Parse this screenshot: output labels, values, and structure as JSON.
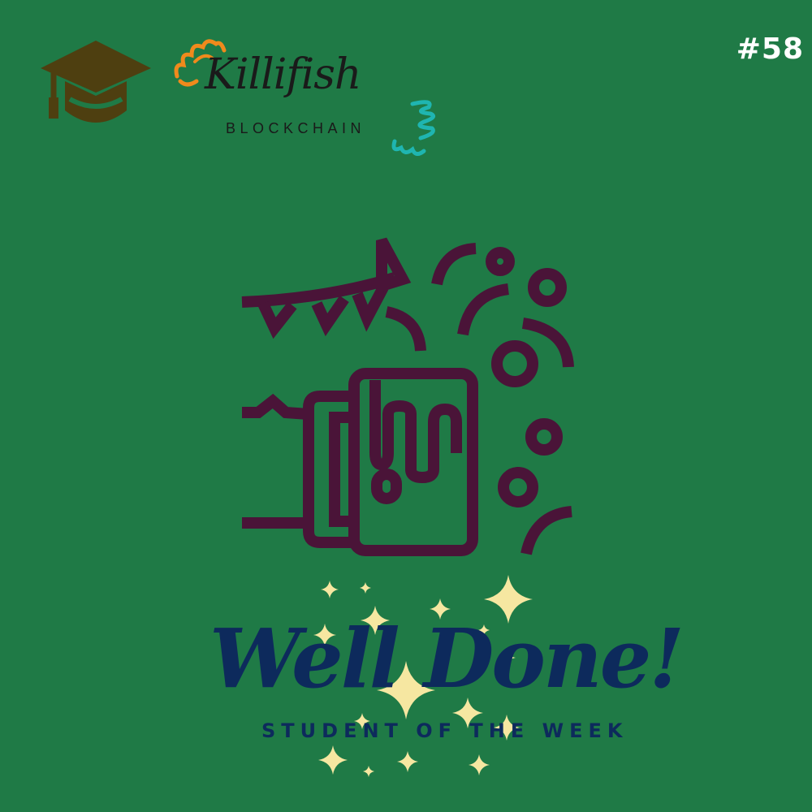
{
  "badge": {
    "number": "#58"
  },
  "logo": {
    "word": "Killifish",
    "sub": "BLOCKCHAIN"
  },
  "banner": {
    "title": "Well Done!",
    "subtitle": "STUDENT OF THE WEEK"
  },
  "icons": {
    "cap": "graduation-cap-icon",
    "illustration": "celebration-mug-icon",
    "sparkles": "sparkles-icon"
  },
  "colors": {
    "background": "#1f7a46",
    "illustration": "#4a1438",
    "title": "#0d2a5c",
    "sparkle": "#f6e7a1",
    "cap": "#4e3f10",
    "swirl_orange": "#f08a1c",
    "swirl_teal": "#1fb5b0"
  }
}
